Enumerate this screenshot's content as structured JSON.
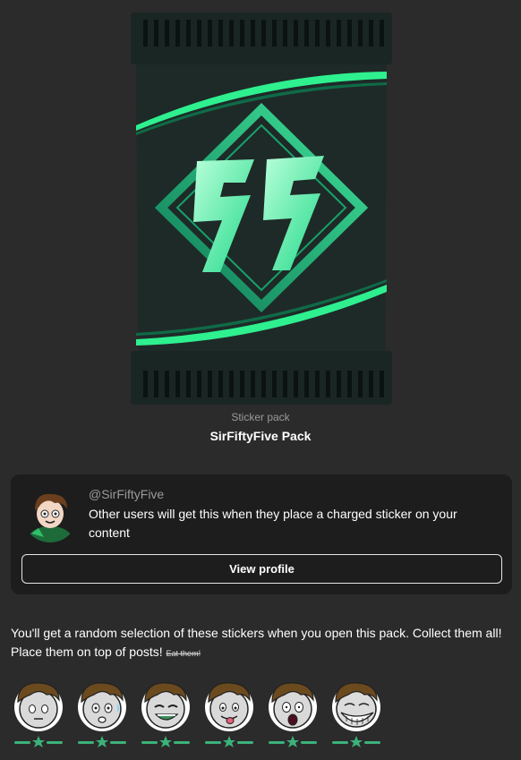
{
  "pack": {
    "kind_label": "Sticker pack",
    "title": "SirFiftyFive Pack",
    "logo_icon": "ss-lightning-logo-icon",
    "colors": {
      "accent": "#3fe29a",
      "accent_dark": "#0f8a5e",
      "body": "#1e2a28",
      "edge": "#15201e"
    }
  },
  "creator": {
    "handle": "@SirFiftyFive",
    "description": "Other users will get this when they place a charged sticker on your content",
    "view_profile_label": "View profile",
    "avatar_icon": "cartoon-avatar-icon"
  },
  "info": {
    "text": "You'll get a random selection of these stickers when you open this pack. Collect them all! Place them on top of posts!",
    "small_text": "Eat them!"
  },
  "stickers": [
    {
      "name": "sticker-blank-face",
      "rarity_icon": "star-icon"
    },
    {
      "name": "sticker-nervous-face",
      "rarity_icon": "star-icon"
    },
    {
      "name": "sticker-grin-face",
      "rarity_icon": "star-icon"
    },
    {
      "name": "sticker-tongue-face",
      "rarity_icon": "star-icon"
    },
    {
      "name": "sticker-shocked-face",
      "rarity_icon": "star-icon"
    },
    {
      "name": "sticker-troll-face",
      "rarity_icon": "star-icon"
    }
  ]
}
